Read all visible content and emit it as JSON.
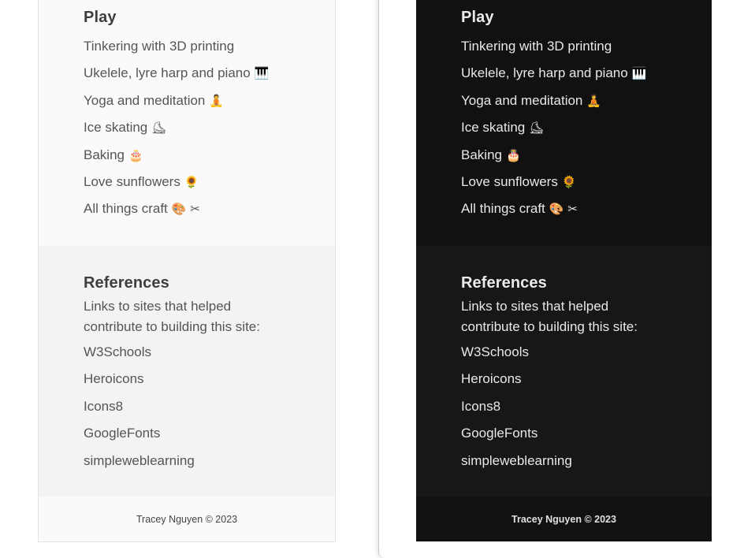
{
  "play": {
    "heading": "Play",
    "items": [
      {
        "text": "Tinkering with 3D printing",
        "emoji": ""
      },
      {
        "text": "Ukelele, lyre harp and piano",
        "emoji": "🎹"
      },
      {
        "text": "Yoga and meditation",
        "emoji": "🧘"
      },
      {
        "text": "Ice skating",
        "emoji": "⛸"
      },
      {
        "text": "Baking",
        "emoji": "🎂"
      },
      {
        "text": "Love sunflowers",
        "emoji": "🌻"
      },
      {
        "text": "All things craft",
        "emoji": "🎨 ✂"
      }
    ]
  },
  "references": {
    "heading": "References",
    "description": "Links to sites that helped contribute to building this site:",
    "links": [
      "W3Schools",
      "Heroicons",
      "Icons8",
      "GoogleFonts",
      "simpleweblearning"
    ]
  },
  "footer": {
    "text": "Tracey Nguyen © 2023"
  },
  "colors": {
    "light_background": "#fafafa",
    "dark_background": "#111111"
  }
}
